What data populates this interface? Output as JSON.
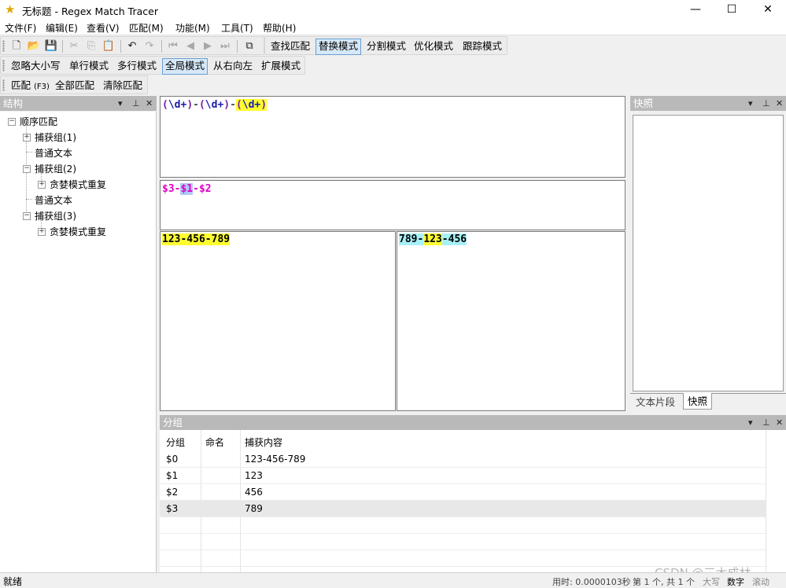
{
  "window": {
    "title": "无标题 - Regex Match Tracer",
    "controls": [
      "—",
      "☐",
      "✕"
    ]
  },
  "menu": [
    "文件(F)",
    "编辑(E)",
    "查看(V)",
    "匹配(M)",
    "功能(M)",
    "工具(T)",
    "帮助(H)"
  ],
  "mode_toolbar": {
    "buttons": [
      "查找匹配",
      "替换模式",
      "分割模式",
      "优化模式",
      "跟踪模式"
    ],
    "active": "替换模式"
  },
  "options_toolbar": {
    "buttons": [
      "忽略大小写",
      "单行模式",
      "多行模式",
      "全局模式",
      "从右向左",
      "扩展模式"
    ],
    "active": "全局模式"
  },
  "match_toolbar": {
    "match_label": "匹配",
    "match_shortcut": "(F3)",
    "match_all": "全部匹配",
    "clear_match": "清除匹配"
  },
  "structure_panel": {
    "title": "结构",
    "tree": [
      {
        "label": "顺序匹配",
        "expander": "−"
      },
      {
        "label": "捕获组(1)",
        "expander": "+"
      },
      {
        "label": "普通文本",
        "expander": ""
      },
      {
        "label": "捕获组(2)",
        "expander": "−"
      },
      {
        "label": "贪婪模式重复",
        "expander": "+"
      },
      {
        "label": "普通文本",
        "expander": ""
      },
      {
        "label": "捕获组(3)",
        "expander": "−"
      },
      {
        "label": "贪婪模式重复",
        "expander": "+"
      }
    ]
  },
  "regex": {
    "tokens": [
      {
        "text": "(",
        "kind": "paren"
      },
      {
        "text": "\\d+",
        "kind": "class"
      },
      {
        "text": ")",
        "kind": "paren"
      },
      {
        "text": "-",
        "kind": "literal"
      },
      {
        "text": "(",
        "kind": "paren"
      },
      {
        "text": "\\d+",
        "kind": "class"
      },
      {
        "text": ")",
        "kind": "paren"
      },
      {
        "text": "-",
        "kind": "literal"
      },
      {
        "text": "(",
        "kind": "paren-hl"
      },
      {
        "text": "\\d+",
        "kind": "class-hl"
      },
      {
        "text": ")",
        "kind": "paren-hl"
      }
    ]
  },
  "replacement": {
    "tokens": [
      {
        "text": "$3",
        "kind": "ref"
      },
      {
        "text": "-",
        "kind": "ref"
      },
      {
        "text": "$1",
        "kind": "ref-hl"
      },
      {
        "text": "-",
        "kind": "ref"
      },
      {
        "text": "$2",
        "kind": "ref"
      }
    ]
  },
  "source_text": "123-456-789",
  "result": {
    "tokens": [
      {
        "text": "789",
        "bg": "#a8f0f8"
      },
      {
        "text": "-",
        "bg": "#a8f0f8"
      },
      {
        "text": "123",
        "bg": "#ffff30"
      },
      {
        "text": "-456",
        "bg": "#a8f0f8"
      }
    ]
  },
  "snapshot_panel": {
    "title": "快照",
    "tabs": [
      "文本片段",
      "快照"
    ],
    "active_tab": "快照"
  },
  "groups_panel": {
    "title": "分组",
    "columns": [
      "分组",
      "命名",
      "捕获内容"
    ],
    "rows": [
      {
        "group": "$0",
        "name": "",
        "content": "123-456-789"
      },
      {
        "group": "$1",
        "name": "",
        "content": "123"
      },
      {
        "group": "$2",
        "name": "",
        "content": "456"
      },
      {
        "group": "$3",
        "name": "",
        "content": "789"
      }
    ],
    "selected_row": 3
  },
  "status": {
    "ready": "就绪",
    "time": "用时: 0.0000103秒",
    "match_info": "第 1 个, 共 1 个",
    "caps": "大写",
    "num": "数字",
    "scroll": "滚动"
  },
  "watermark": "CSDN @三木成林",
  "colors": {
    "paren": "#7a1fa2",
    "class": "#1a1aaa",
    "hl_yellow": "#ffff30",
    "ref": "#e000c8",
    "ref_hl_bg": "#b0c8f8",
    "result_cyan": "#a8f0f8",
    "panel_head": "#b9b9b9"
  }
}
